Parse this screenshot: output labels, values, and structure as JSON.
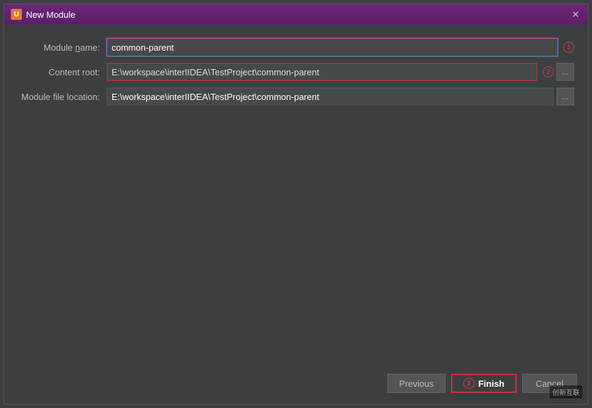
{
  "dialog": {
    "title": "New Module",
    "title_icon": "U"
  },
  "form": {
    "module_name_label": "Module name:",
    "module_name_underline_char": "n",
    "module_name_value": "common-parent",
    "module_name_annotation": "1",
    "content_root_label": "Content root:",
    "content_root_value": "E:\\workspace\\interIIDEA\\TestProject\\common-parent",
    "content_root_annotation": "2",
    "module_file_location_label": "Module file location:",
    "module_file_location_value": "E:\\workspace\\interIIDEA\\TestProject\\common-parent",
    "browse_label": "..."
  },
  "footer": {
    "previous_label": "Previous",
    "finish_label": "Finish",
    "finish_annotation": "3",
    "cancel_label": "Cancel"
  },
  "watermark": {
    "text": "创新互联"
  }
}
